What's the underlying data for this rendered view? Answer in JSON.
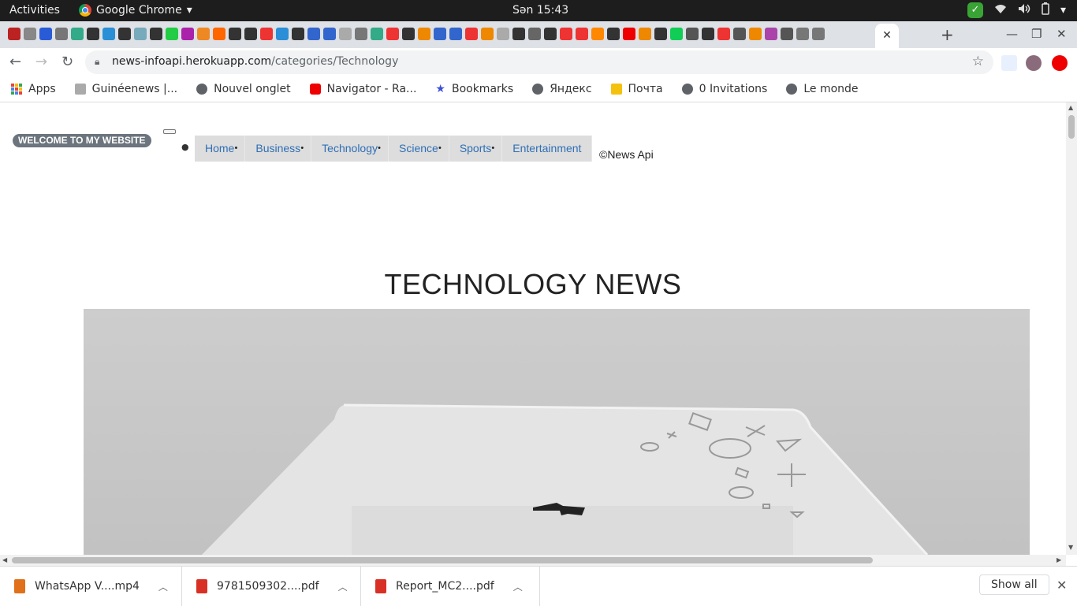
{
  "os_bar": {
    "activities": "Activities",
    "app_name": "Google Chrome",
    "clock": "Sən 15:43"
  },
  "browser": {
    "active_tab_close": "✕",
    "url_host": "news-infoapi.herokuapp.com",
    "url_path": "/categories/Technology"
  },
  "bookmarks": [
    {
      "label": "Apps"
    },
    {
      "label": "Guinéenews |..."
    },
    {
      "label": "Nouvel onglet"
    },
    {
      "label": "Navigator - Ra..."
    },
    {
      "label": "Bookmarks"
    },
    {
      "label": "Яндекс"
    },
    {
      "label": "Почта"
    },
    {
      "label": "0 Invitations"
    },
    {
      "label": "Le monde"
    }
  ],
  "page": {
    "brand": "WELCOME TO MY WEBSITE",
    "nav": [
      "Home",
      "Business",
      "Technology",
      "Science",
      "Sports",
      "Entertainment"
    ],
    "copyright": "©News Api",
    "heading": "TECHNOLOGY NEWS"
  },
  "downloads": {
    "items": [
      "WhatsApp V....mp4",
      "9781509302....pdf",
      "Report_MC2....pdf"
    ],
    "show_all": "Show all"
  },
  "colors": {
    "brand_pill": "#6c757d",
    "nav_link": "#2f6fb5",
    "nav_bg": "#dddddd"
  }
}
